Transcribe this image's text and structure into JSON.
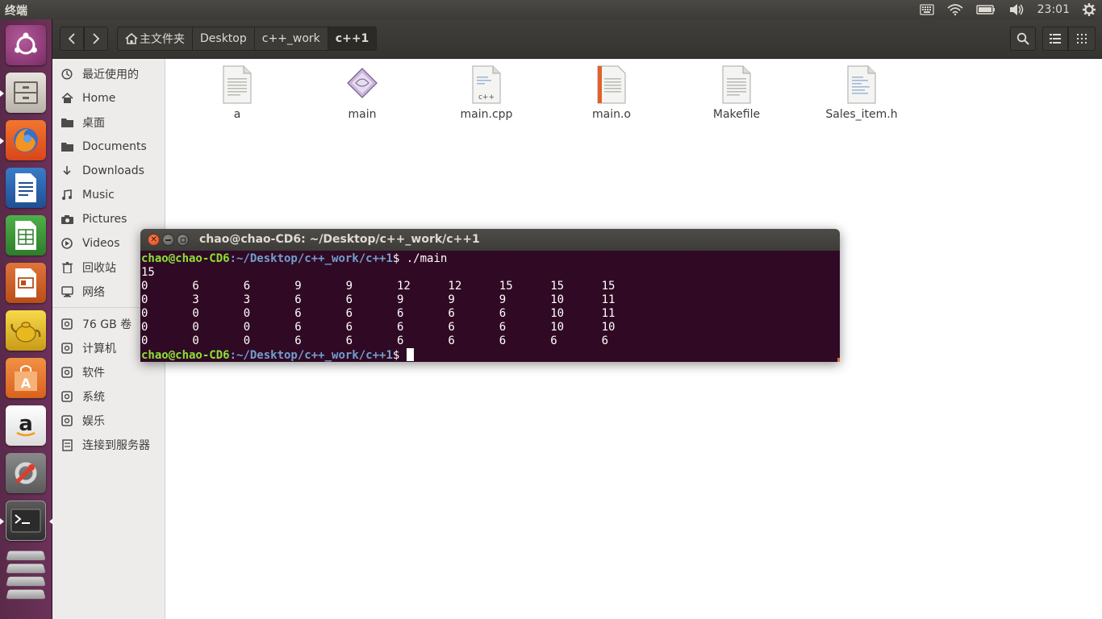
{
  "top_panel": {
    "app_title": "终端",
    "clock": "23:01",
    "indicators": [
      "keyboard-icon",
      "wifi-icon",
      "battery-icon",
      "volume-icon",
      "gear-icon"
    ]
  },
  "launcher": {
    "items": [
      "ubuntu-dash",
      "files",
      "firefox",
      "writer",
      "calc",
      "impress",
      "teapot",
      "software-center",
      "amazon",
      "system-settings",
      "terminal",
      "workspaces"
    ]
  },
  "file_manager": {
    "pathbar": [
      "主文件夹",
      "Desktop",
      "c++_work",
      "c++1"
    ],
    "sidebar": [
      {
        "label": "最近使用的",
        "icon": "clock-icon"
      },
      {
        "label": "Home",
        "icon": "home-icon"
      },
      {
        "label": "桌面",
        "icon": "folder-icon"
      },
      {
        "label": "Documents",
        "icon": "folder-icon"
      },
      {
        "label": "Downloads",
        "icon": "download-icon"
      },
      {
        "label": "Music",
        "icon": "music-icon"
      },
      {
        "label": "Pictures",
        "icon": "camera-icon"
      },
      {
        "label": "Videos",
        "icon": "video-icon"
      },
      {
        "label": "回收站",
        "icon": "trash-icon"
      },
      {
        "label": "网络",
        "icon": "network-icon"
      },
      {
        "label": "76 GB 卷",
        "icon": "drive-icon"
      },
      {
        "label": "计算机",
        "icon": "drive-icon"
      },
      {
        "label": "软件",
        "icon": "drive-icon"
      },
      {
        "label": "系统",
        "icon": "drive-icon"
      },
      {
        "label": "娱乐",
        "icon": "drive-icon"
      },
      {
        "label": "连接到服务器",
        "icon": "server-icon"
      }
    ],
    "files": [
      {
        "name": "a",
        "icon": "text-file-icon"
      },
      {
        "name": "main",
        "icon": "executable-icon"
      },
      {
        "name": "main.cpp",
        "icon": "cpp-file-icon"
      },
      {
        "name": "main.o",
        "icon": "object-file-icon"
      },
      {
        "name": "Makefile",
        "icon": "text-file-icon"
      },
      {
        "name": "Sales_item.h",
        "icon": "header-file-icon"
      }
    ]
  },
  "terminal": {
    "title": "chao@chao-CD6: ~/Desktop/c++_work/c++1",
    "prompt_user": "chao@chao-CD6",
    "prompt_path": ":~/Desktop/c++_work/c++1",
    "prompt_symbol": "$",
    "command": " ./main",
    "output_first": "15",
    "rows": [
      [
        "0",
        "6",
        "6",
        "9",
        "9",
        "12",
        "12",
        "15",
        "15",
        "15"
      ],
      [
        "0",
        "3",
        "3",
        "6",
        "6",
        "9",
        "9",
        "9",
        "10",
        "11"
      ],
      [
        "0",
        "0",
        "0",
        "6",
        "6",
        "6",
        "6",
        "6",
        "10",
        "11"
      ],
      [
        "0",
        "0",
        "0",
        "6",
        "6",
        "6",
        "6",
        "6",
        "10",
        "10"
      ],
      [
        "0",
        "0",
        "0",
        "6",
        "6",
        "6",
        "6",
        "6",
        "6",
        "6"
      ]
    ]
  }
}
